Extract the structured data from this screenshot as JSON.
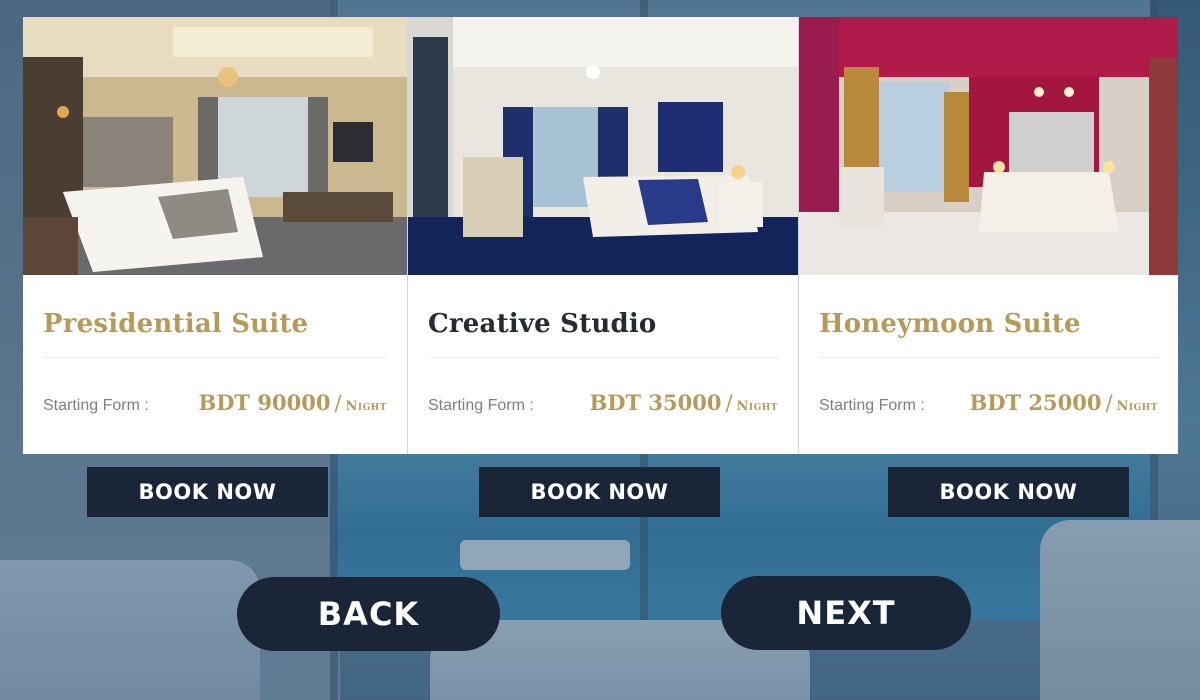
{
  "rooms": [
    {
      "title": "Presidential Suite",
      "price_label": "Starting Form :",
      "price": "BDT 90000",
      "slash": "/",
      "unit": "Night",
      "book_label": "BOOK NOW"
    },
    {
      "title": "Creative Studio",
      "price_label": "Starting Form :",
      "price": "BDT 35000",
      "slash": "/",
      "unit": "Night",
      "book_label": "BOOK NOW"
    },
    {
      "title": "Honeymoon Suite",
      "price_label": "Starting Form :",
      "price": "BDT 25000",
      "slash": "/",
      "unit": "Night",
      "book_label": "BOOK NOW"
    }
  ],
  "nav": {
    "back_label": "BACK",
    "next_label": "NEXT"
  },
  "colors": {
    "accent_gold": "#b59a5c",
    "button_navy": "#1b2538",
    "title_dark": "#262b33"
  }
}
